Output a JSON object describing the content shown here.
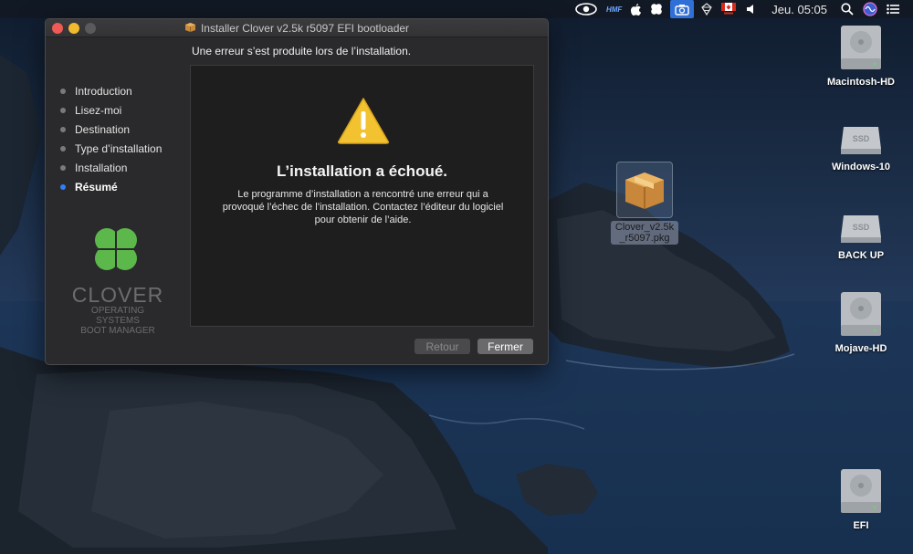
{
  "menubar": {
    "hmf_label": "HMF",
    "clock": "Jeu. 05:05"
  },
  "window": {
    "title": "Installer Clover v2.5k r5097 EFI bootloader",
    "subtitle": "Une erreur s’est produite lors de l’installation.",
    "steps": [
      {
        "label": "Introduction",
        "current": false
      },
      {
        "label": "Lisez-moi",
        "current": false
      },
      {
        "label": "Destination",
        "current": false
      },
      {
        "label": "Type d’installation",
        "current": false
      },
      {
        "label": "Installation",
        "current": false
      },
      {
        "label": "Résumé",
        "current": true
      }
    ],
    "logo": {
      "word": "CLOVER",
      "line1": "OPERATING SYSTEMS",
      "line2": "BOOT MANAGER"
    },
    "content": {
      "heading": "L’installation a échoué.",
      "message": "Le programme d’installation a rencontré une erreur qui a provoqué l’échec de l’installation. Contactez l’éditeur du logiciel pour obtenir de l’aide."
    },
    "buttons": {
      "back": "Retour",
      "close": "Fermer"
    }
  },
  "desktop": {
    "drives": [
      {
        "label": "Macintosh-HD"
      },
      {
        "label": "Windows-10",
        "badge": "SSD"
      },
      {
        "label": "BACK UP",
        "badge": "SSD"
      },
      {
        "label": "Mojave-HD"
      },
      {
        "label": "EFI"
      }
    ],
    "package": {
      "label": "Clover_v2.5k_r5097.pkg"
    }
  },
  "colors": {
    "accent": "#2f7ff7",
    "warning": "#f2c230",
    "clover_green": "#5cb84a"
  }
}
